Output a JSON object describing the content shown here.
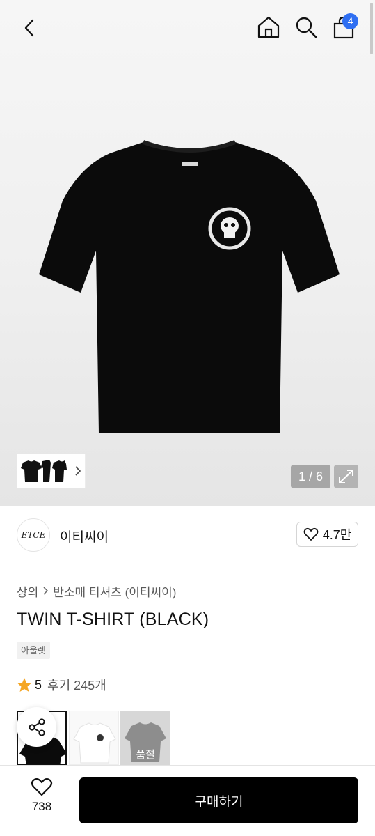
{
  "header": {
    "back_icon": "chevron-left-icon",
    "home_icon": "home-icon",
    "search_icon": "search-icon",
    "bag_icon": "shopping-bag-icon",
    "bag_count": "4",
    "badge_color": "#2f6ff2"
  },
  "gallery": {
    "counter": "1 / 6",
    "expand_icon": "expand-icon"
  },
  "brand": {
    "logo_text": "ETCE",
    "name": "이티씨이",
    "like_count": "4.7만"
  },
  "product": {
    "breadcrumb": [
      "상의",
      "반소매 티셔츠 (이티씨이)"
    ],
    "title": "TWIN T-SHIRT (BLACK)",
    "tag": "아울렛",
    "rating": "5",
    "review_label": "후기 245개",
    "star_color": "#f5a623"
  },
  "options": {
    "sold_out_label": "품절"
  },
  "bottom": {
    "wish_count": "738",
    "buy_label": "구매하기"
  }
}
